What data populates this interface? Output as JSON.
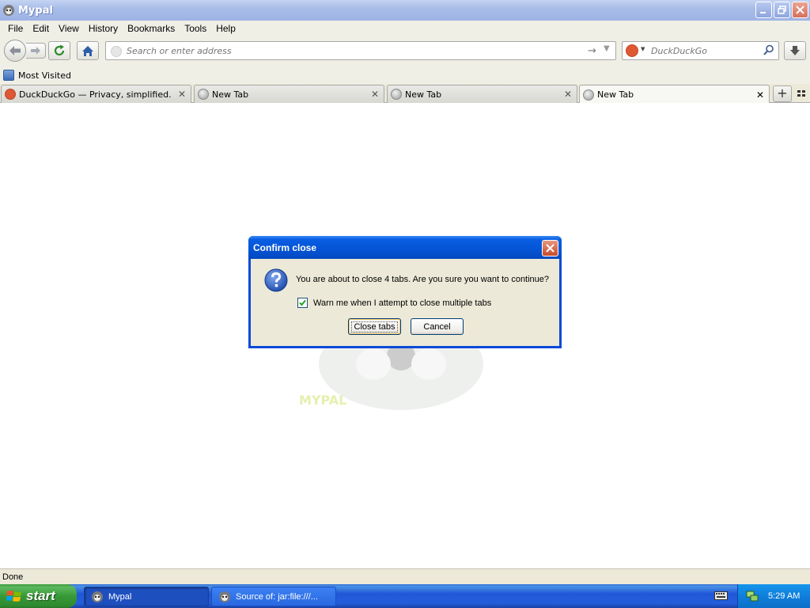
{
  "window": {
    "title": "Mypal"
  },
  "menu": {
    "items": [
      {
        "label": "File"
      },
      {
        "label": "Edit"
      },
      {
        "label": "View"
      },
      {
        "label": "History"
      },
      {
        "label": "Bookmarks"
      },
      {
        "label": "Tools"
      },
      {
        "label": "Help"
      }
    ]
  },
  "navbar": {
    "url_placeholder": "Search or enter address",
    "search_placeholder": "DuckDuckGo"
  },
  "bookmarks": {
    "items": [
      {
        "label": "Most Visited"
      }
    ]
  },
  "tabs": [
    {
      "label": "DuckDuckGo — Privacy, simplified.",
      "icon": "duckduckgo-icon",
      "selected": false
    },
    {
      "label": "New Tab",
      "icon": "globe-icon",
      "selected": false
    },
    {
      "label": "New Tab",
      "icon": "globe-icon",
      "selected": false
    },
    {
      "label": "New Tab",
      "icon": "globe-icon",
      "selected": true
    }
  ],
  "dialog": {
    "title": "Confirm close",
    "message": "You are about to close 4 tabs. Are you sure you want to continue?",
    "checkbox_label": "Warn me when I attempt to close multiple tabs",
    "checkbox_checked": true,
    "confirm_label": "Close tabs",
    "cancel_label": "Cancel"
  },
  "content": {
    "watermark_text": "MYPAL"
  },
  "status": {
    "text": "Done"
  },
  "taskbar": {
    "start_label": "start",
    "tasks": [
      {
        "label": "Mypal",
        "active": true
      },
      {
        "label": "Source of: jar:file:///...",
        "active": false
      }
    ],
    "clock": "5:29 AM"
  },
  "colors": {
    "dialog_title": "#0454d4",
    "taskbar": "#245edb",
    "start_button": "#379937",
    "duckduckgo": "#de5833"
  }
}
